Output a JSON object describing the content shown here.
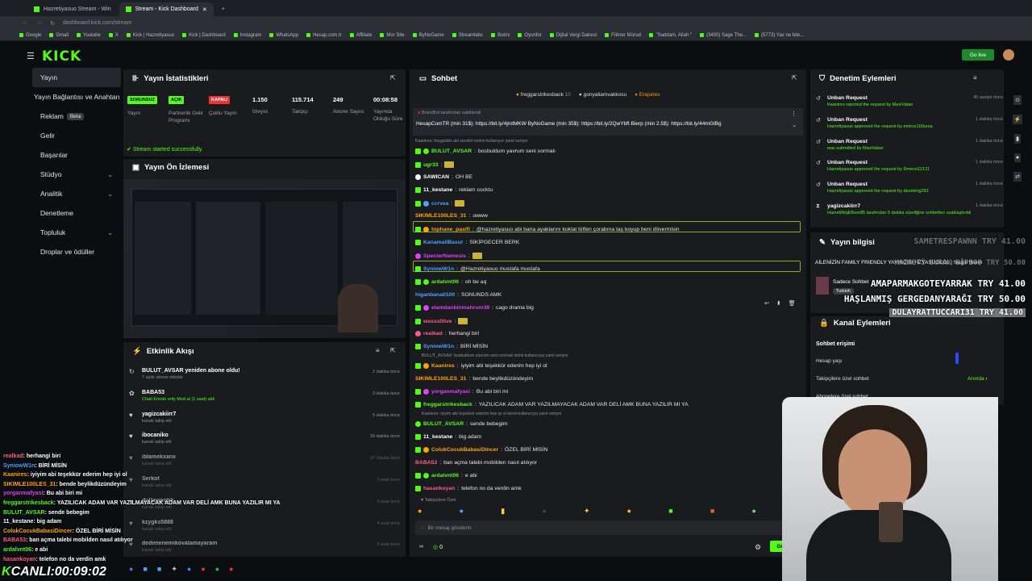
{
  "browser": {
    "tabs": [
      "Hazretiyasuo Stream - Win",
      "Stream - Kick Dashboard"
    ],
    "url": "dashboard.kick.com/stream",
    "bookmarks": [
      "Google",
      "Gmail",
      "Youtube",
      "X",
      "Kick | Hazretiyasuo",
      "Kick | Dashboard",
      "Instagram",
      "WhatsApp",
      "Hesap.com.tr",
      "Affiliate",
      "Mor Site",
      "ByNoGame",
      "Streamlabs",
      "Botrix",
      "Oyunfor",
      "Dijital Vergi Dairesi",
      "Führer Mürsel",
      "\"Saddam, Allah \"",
      "(3400) Sage The...",
      "(5773) Yav ne bile..."
    ]
  },
  "app": {
    "logo": "KICK",
    "go_live": "Go live"
  },
  "sidebar": {
    "items": [
      {
        "label": "Yayın"
      },
      {
        "label": "Yayın Bağlantısı ve Anahtarı"
      },
      {
        "label": "Reklam",
        "badge": "Beta"
      },
      {
        "label": "Gelir"
      },
      {
        "label": "Başarılar"
      },
      {
        "label": "Stüdyo"
      },
      {
        "label": "Analitik"
      },
      {
        "label": "Denetleme"
      },
      {
        "label": "Topluluk"
      },
      {
        "label": "Droplar ve ödüller"
      }
    ]
  },
  "stats": {
    "title": "Yayın İstatistikleri",
    "items": [
      {
        "badge": "SORUNSUZ",
        "label": "Yayın"
      },
      {
        "badge": "AÇIK",
        "label": "Partnerlik Gelir Programı"
      },
      {
        "badge": "KAPALI",
        "label": "Çoklu Yayın"
      },
      {
        "value": "1.150",
        "label": "İzleyici"
      },
      {
        "value": "115.714",
        "label": "Takipçi"
      },
      {
        "value": "249",
        "label": "Abone Sayısı"
      },
      {
        "value": "00:08:58",
        "label": "Yayında Olduğu Süre"
      }
    ],
    "status": "Stream started successfully."
  },
  "preview": {
    "title": "Yayın Ön İzlemesi"
  },
  "activity": {
    "title": "Etkinlik Akışı",
    "items": [
      {
        "name": "BULUT_AVSAR yeniden abone oldu!",
        "sub": "7 aylık abone oldular",
        "time": "2 dakika önce"
      },
      {
        "name": "BABA53",
        "sub": "Chati Emote only Mod al (1 saat) aldı",
        "time": "3 dakika önce"
      },
      {
        "name": "yagizcakiirr7",
        "sub": "kanalı takip etti",
        "time": "5 dakika önce"
      },
      {
        "name": "ibocaniko",
        "sub": "kanalı takip etti",
        "time": "28 dakika önce"
      },
      {
        "name": "iblamekxanx",
        "sub": "kanalı takip etti",
        "time": "37 dakika önce"
      },
      {
        "name": "Serkot",
        "sub": "kanalı takip etti",
        "time": "1 saat önce"
      },
      {
        "name": "dullmanstrk",
        "sub": "kanalı takip etti",
        "time": "3 saat önce"
      },
      {
        "name": "kzygks5888",
        "sub": "kanalı takip etti",
        "time": "4 saat önce"
      },
      {
        "name": "dedenenemikovalamayaram",
        "sub": "kanalı takip etti",
        "time": "5 saat önce"
      }
    ]
  },
  "chat": {
    "title": "Sohbet",
    "top": [
      "freggarstrikesback",
      "gonyaliamvakkosu",
      "Enquires"
    ],
    "top_counts": [
      "10",
      "",
      ""
    ],
    "pinned_by": "BotrixBot tarafından sabitlendi",
    "pinned": "HesapComTR (min 31$): https://bit.ly/4jmtMKW ByNoGame (min 35$): https://bit.ly/2QwYbft Bierp (min 2.5$): https://bit.ly/44mGtBg",
    "reply_hint": "Kaanires: hoşgeldin abi sevdim ismini kullanıyor yanıt veriyor",
    "messages": [
      {
        "user": "BULUT_AVSAR",
        "text": "bosbuldum yavrum seni sormalı",
        "color": "#53fc18"
      },
      {
        "user": "ugr33",
        "text": "",
        "color": "#53fc18"
      },
      {
        "user": "SAWICAN",
        "text": "OH BE",
        "color": "#fff"
      },
      {
        "user": "11_kestane",
        "text": "reklam cocktu",
        "color": "#fff"
      },
      {
        "user": "ccrvea",
        "text": "",
        "color": "#4aa3ff"
      },
      {
        "user": "SIKIMLE100LES_31",
        "text": "owww",
        "color": "#ffa500"
      },
      {
        "user": "tophane_pasifi",
        "text": "@hazretiyasuo abi bana ayaklarını koklat lütfen çorabına taş koyup beni dövermisin",
        "color": "#ffa500"
      },
      {
        "user": "KanamaliBasur",
        "text": "SİKİPGECER BERK",
        "color": "#4aa3ff"
      },
      {
        "user": "SpecterNemesis",
        "text": "",
        "color": "#e040fb"
      },
      {
        "user": "SyniowW1n",
        "text": "@Hazretiyasuo mustafa mustafa",
        "color": "#4aa3ff"
      },
      {
        "user": "ardalvnt06",
        "text": "oh be aq",
        "color": "#53fc18"
      },
      {
        "user": "higanbana0100",
        "text": "SONUNDS AMK",
        "color": "#4aa3ff"
      },
      {
        "user": "elamdanbinmahrum38",
        "text": "cago drama big",
        "color": "#e040fb"
      },
      {
        "user": "wasss0live",
        "text": "",
        "color": "#ff5e8a"
      },
      {
        "user": "realkad",
        "text": "herhangi biri",
        "color": "#ff5e8a"
      },
      {
        "user": "SyniowW1n",
        "text": "BİRİ MİSİN",
        "color": "#4aa3ff"
      },
      {
        "user": "Kaanires",
        "text": "iyiyim abi teşekkür ederim hep iyi ol",
        "color": "#ffa500"
      },
      {
        "user": "SIKIMLE100LES_31",
        "text": "bende beylikdüzündeyim",
        "color": "#ffa500"
      },
      {
        "user": "yorganmafyasi",
        "text": "Bu abi biri mi",
        "color": "#e040fb"
      },
      {
        "user": "freggarstrikesback",
        "text": "YAZILICAK ADAM VAR YAZILMAYACAK ADAM VAR DELİ AMK BUNA YAZILIR MI YA",
        "color": "#53fc18"
      },
      {
        "user": "BULUT_AVSAR",
        "text": "sende bebegim",
        "color": "#53fc18"
      },
      {
        "user": "11_kestane",
        "text": "big adam",
        "color": "#fff"
      },
      {
        "user": "ColukCocukBabasiDincer",
        "text": "ÖZEL BİRİ MİSİN",
        "color": "#ffa500"
      },
      {
        "user": "BABA53",
        "text": "ban açma talebi mobilden nasıl atılıyor",
        "color": "#ff5e8a"
      },
      {
        "user": "ardalvnt06",
        "text": "e abi",
        "color": "#53fc18"
      },
      {
        "user": "hasankoyan",
        "text": "telefon no da verdin amk",
        "color": "#ff5e8a"
      }
    ],
    "reply_hint2": "BULUT_AVSAR: bosbuldum yavrum seni sormalı isimli kullanıcıya yanıt veriyor",
    "reply_hint3": "Kaanires: iyiyim abi teşekkür ederim hep iyi ol isimli kullanıcıya yanıt veriyor",
    "followers_only": "Takipçilere Özel",
    "placeholder": "Bir mesaj gönderin",
    "count": "0",
    "send": "Gönder"
  },
  "modlog": {
    "title": "Denetim Eylemleri",
    "items": [
      {
        "name": "Unban Request",
        "sub": "Kaanires rejected the request by MaviVatan",
        "time": "45 saniye önce"
      },
      {
        "name": "Unban Request",
        "sub": "Hazretiyasuo approved the request by emirss160ursa",
        "time": "1 dakika önce"
      },
      {
        "name": "Unban Request",
        "sub": "was submitted by MaviVatan",
        "time": "1 dakika önce"
      },
      {
        "name": "Unban Request",
        "sub": "Hazretiyasuo approved the request by Rmeco12121",
        "time": "1 dakika önce"
      },
      {
        "name": "Unban Request",
        "sub": "Hazretiyasuo approved the request by daveking292",
        "time": "1 dakika önce"
      },
      {
        "name": "yagizcakiirr7",
        "sub": "HazretiNiqEflson85 tarafından 5 dakika süreliğine sohbetten uzaklaştırıldı",
        "time": "1 dakika önce"
      }
    ]
  },
  "streaminfo": {
    "title": "Yayın bilgisi",
    "stream_title": "AİLENİZİN FAMILY FRIENDLY YAYINCISI HZYASUOLOL | !bagis !bierp",
    "category": "Sadece Sohbet",
    "language": "Turkish"
  },
  "channel": {
    "title": "Kanal Eylemleri",
    "section": "Sohbet erişimi",
    "age": "Hesap yaşı",
    "followers_chat": "Takipçilere özel sohbet",
    "followers_chat_val": "Anında",
    "subs_chat": "Abonelere özel sohbet"
  },
  "overlay_chat": [
    {
      "user": "realkad",
      "text": "herhangi biri"
    },
    {
      "user": "SyniowW1n",
      "text": "BİRİ MİSİN"
    },
    {
      "user": "Kaanires",
      "text": "iyiyim abi teşekkür ederim hep iyi ol"
    },
    {
      "user": "SIKIMLE100LES_31",
      "text": "bende beylikdüzündeyim"
    },
    {
      "user": "yorganmafyasi",
      "text": "Bu abi biri mi"
    },
    {
      "user": "freggarstrikesback",
      "text": "YAZILICAK ADAM VAR YAZILMAYACAK ADAM VAR DELİ AMK BUNA YAZILIR MI YA"
    },
    {
      "user": "BULUT_AVSAR",
      "text": "sende bebegim"
    },
    {
      "user": "11_kestane",
      "text": "big adam"
    },
    {
      "user": "ColukCocukBabasiDincer",
      "text": "ÖZEL BİRİ MİSİN"
    },
    {
      "user": "BABA53",
      "text": "ban açma talebi mobilden nasıl atılıyor"
    },
    {
      "user": "ardalvnt06",
      "text": "e abi"
    },
    {
      "user": "hasankoyan",
      "text": "telefon no da verdin amk"
    }
  ],
  "live_timer": "CANLI:00:09:02",
  "donations": [
    {
      "text": "SAMETRESPAWNN TRY 41.00"
    },
    {
      "text": "HAZRETİ BURAK BİPBOP TRY 50.00"
    },
    {
      "text": "AMAPARMAKGOTEYARRAK TRY 41.00"
    },
    {
      "text": "HAŞLANMIŞ GERGEDANYARAĞI TRY 50.00"
    },
    {
      "text": "DULAYRATTUCCARI31 TRY 41.00"
    }
  ]
}
